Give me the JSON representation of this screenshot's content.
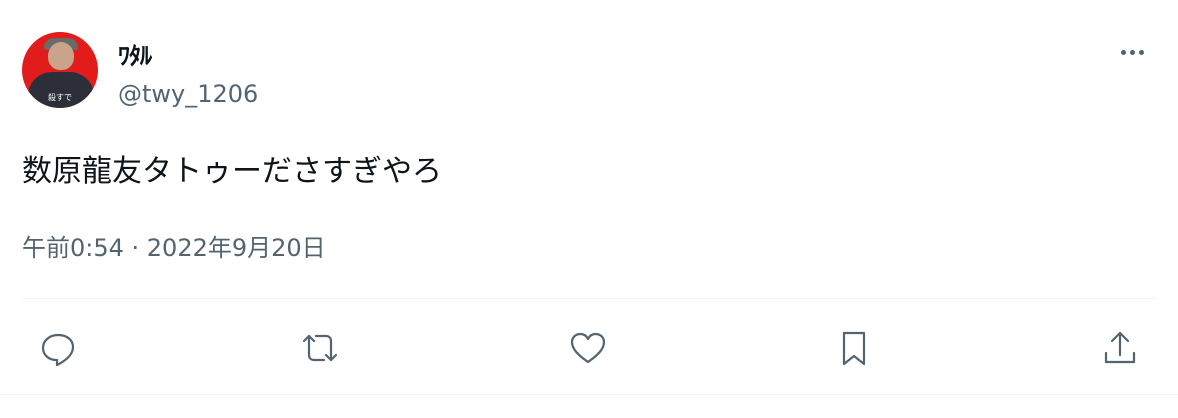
{
  "user": {
    "display_name": "ﾜﾀﾙ",
    "handle": "@twy_1206",
    "avatar_caption": "殺すで"
  },
  "tweet": {
    "text": "数原龍友タトゥーださすぎやろ",
    "time": "午前0:54 · 2022年9月20日"
  },
  "icons": {
    "more": "more-dots-icon",
    "reply": "reply-bubble-icon",
    "retweet": "retweet-arrows-icon",
    "like": "heart-icon",
    "bookmark": "bookmark-icon",
    "share": "share-upload-icon"
  },
  "colors": {
    "text": "#0f1419",
    "secondary": "#536471",
    "divider": "#eff3f4",
    "avatar_bg": "#e21b1b"
  }
}
